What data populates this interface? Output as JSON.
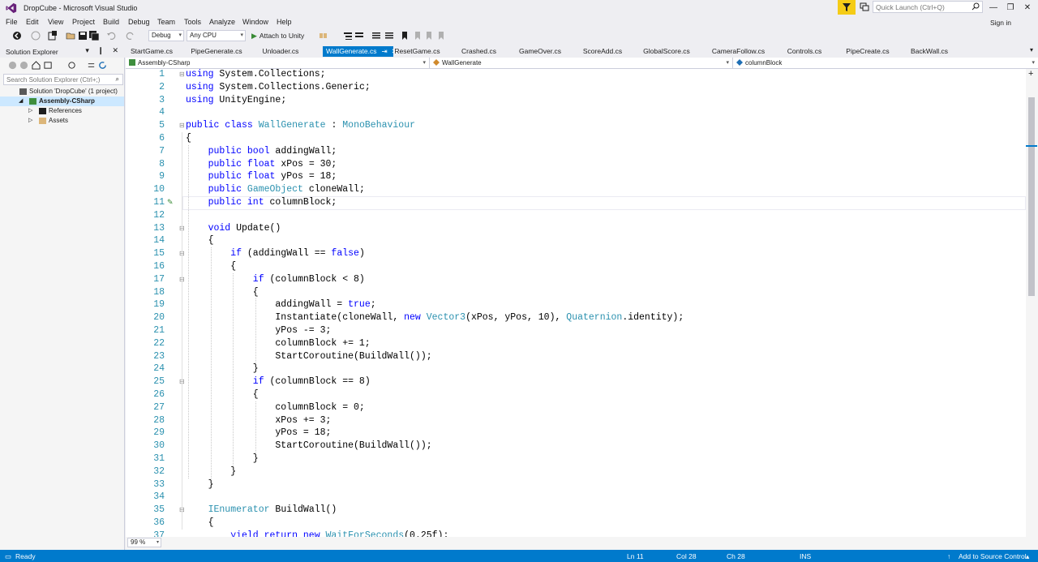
{
  "window": {
    "title": "DropCube - Microsoft Visual Studio",
    "quick_launch_placeholder": "Quick Launch (Ctrl+Q)",
    "sign_in": "Sign in",
    "controls": {
      "minimize": "—",
      "restore": "❐",
      "close": "✕"
    }
  },
  "menu": [
    "File",
    "Edit",
    "View",
    "Project",
    "Build",
    "Debug",
    "Team",
    "Tools",
    "Analyze",
    "Window",
    "Help"
  ],
  "toolbar": {
    "config": "Debug",
    "platform": "Any CPU",
    "attach": "Attach to Unity"
  },
  "solution_explorer": {
    "title": "Solution Explorer",
    "header_buttons": "▾ ❙ ✕",
    "search_placeholder": "Search Solution Explorer (Ctrl+;)",
    "tree": [
      {
        "label": "Solution 'DropCube' (1 project)",
        "expander": "",
        "level": 0,
        "selected": false,
        "icon": "solution-icon"
      },
      {
        "label": "Assembly-CSharp",
        "expander": "◢",
        "level": 1,
        "selected": true,
        "icon": "csharp-project-icon"
      },
      {
        "label": "References",
        "expander": "▷",
        "level": 2,
        "selected": false,
        "icon": "references-icon"
      },
      {
        "label": "Assets",
        "expander": "▷",
        "level": 2,
        "selected": false,
        "icon": "folder-icon"
      }
    ]
  },
  "tabs": [
    {
      "label": "StartGame.cs",
      "active": false
    },
    {
      "label": "PipeGenerate.cs",
      "active": false
    },
    {
      "label": "Unloader.cs",
      "active": false
    },
    {
      "label": "WallGenerate.cs",
      "active": true,
      "pin": "⇥",
      "close": "✕"
    },
    {
      "label": "ResetGame.cs",
      "active": false
    },
    {
      "label": "Crashed.cs",
      "active": false
    },
    {
      "label": "GameOver.cs",
      "active": false
    },
    {
      "label": "ScoreAdd.cs",
      "active": false
    },
    {
      "label": "GlobalScore.cs",
      "active": false
    },
    {
      "label": "CameraFollow.cs",
      "active": false
    },
    {
      "label": "Controls.cs",
      "active": false
    },
    {
      "label": "PipeCreate.cs",
      "active": false
    },
    {
      "label": "BackWall.cs",
      "active": false
    }
  ],
  "navbar": {
    "project": "Assembly-CSharp",
    "type": "WallGenerate",
    "member": "columnBlock"
  },
  "editor": {
    "zoom": "99 %",
    "lines": [
      {
        "n": "1",
        "fold": "⊟",
        "indent": 0,
        "tokens": [
          [
            "kw",
            "using"
          ],
          [
            "",
            " System.Collections;"
          ]
        ]
      },
      {
        "n": "2",
        "fold": "",
        "indent": 0,
        "tokens": [
          [
            "kw",
            "using"
          ],
          [
            "",
            " System.Collections.Generic;"
          ]
        ]
      },
      {
        "n": "3",
        "fold": "",
        "indent": 0,
        "tokens": [
          [
            "kw",
            "using"
          ],
          [
            "",
            " UnityEngine;"
          ]
        ]
      },
      {
        "n": "4",
        "fold": "",
        "indent": 0,
        "tokens": []
      },
      {
        "n": "5",
        "fold": "⊟",
        "indent": 0,
        "tokens": [
          [
            "kw",
            "public class"
          ],
          [
            "",
            " "
          ],
          [
            "ty",
            "WallGenerate"
          ],
          [
            "",
            " : "
          ],
          [
            "ty",
            "MonoBehaviour"
          ]
        ]
      },
      {
        "n": "6",
        "fold": "",
        "indent": 0,
        "tokens": [
          [
            "",
            "{"
          ]
        ]
      },
      {
        "n": "7",
        "fold": "",
        "indent": 1,
        "tokens": [
          [
            "kw",
            "public bool"
          ],
          [
            "",
            " addingWall;"
          ]
        ]
      },
      {
        "n": "8",
        "fold": "",
        "indent": 1,
        "tokens": [
          [
            "kw",
            "public float"
          ],
          [
            "",
            " xPos = 30;"
          ]
        ]
      },
      {
        "n": "9",
        "fold": "",
        "indent": 1,
        "tokens": [
          [
            "kw",
            "public float"
          ],
          [
            "",
            " yPos = 18;"
          ]
        ]
      },
      {
        "n": "10",
        "fold": "",
        "indent": 1,
        "tokens": [
          [
            "kw",
            "public"
          ],
          [
            "",
            " "
          ],
          [
            "ty",
            "GameObject"
          ],
          [
            "",
            " cloneWall;"
          ]
        ]
      },
      {
        "n": "11",
        "fold": "",
        "indent": 1,
        "tokens": [
          [
            "kw",
            "public int"
          ],
          [
            "",
            " columnBlock;"
          ]
        ]
      },
      {
        "n": "12",
        "fold": "",
        "indent": 0,
        "tokens": []
      },
      {
        "n": "13",
        "fold": "⊟",
        "indent": 1,
        "tokens": [
          [
            "kw",
            "void"
          ],
          [
            "",
            " Update()"
          ]
        ]
      },
      {
        "n": "14",
        "fold": "",
        "indent": 1,
        "tokens": [
          [
            "",
            "{"
          ]
        ]
      },
      {
        "n": "15",
        "fold": "⊟",
        "indent": 2,
        "tokens": [
          [
            "kw",
            "if"
          ],
          [
            "",
            " (addingWall == "
          ],
          [
            "kw",
            "false"
          ],
          [
            "",
            ")"
          ]
        ]
      },
      {
        "n": "16",
        "fold": "",
        "indent": 2,
        "tokens": [
          [
            "",
            "{"
          ]
        ]
      },
      {
        "n": "17",
        "fold": "⊟",
        "indent": 3,
        "tokens": [
          [
            "kw",
            "if"
          ],
          [
            "",
            " (columnBlock < 8)"
          ]
        ]
      },
      {
        "n": "18",
        "fold": "",
        "indent": 3,
        "tokens": [
          [
            "",
            "{"
          ]
        ]
      },
      {
        "n": "19",
        "fold": "",
        "indent": 4,
        "tokens": [
          [
            "",
            "addingWall = "
          ],
          [
            "kw",
            "true"
          ],
          [
            "",
            ";"
          ]
        ]
      },
      {
        "n": "20",
        "fold": "",
        "indent": 4,
        "tokens": [
          [
            "",
            "Instantiate(cloneWall, "
          ],
          [
            "kw",
            "new"
          ],
          [
            "",
            " "
          ],
          [
            "ty",
            "Vector3"
          ],
          [
            "",
            "(xPos, yPos, 10), "
          ],
          [
            "ty",
            "Quaternion"
          ],
          [
            "",
            ".identity);"
          ]
        ]
      },
      {
        "n": "21",
        "fold": "",
        "indent": 4,
        "tokens": [
          [
            "",
            "yPos -= 3;"
          ]
        ]
      },
      {
        "n": "22",
        "fold": "",
        "indent": 4,
        "tokens": [
          [
            "",
            "columnBlock += 1;"
          ]
        ]
      },
      {
        "n": "23",
        "fold": "",
        "indent": 4,
        "tokens": [
          [
            "",
            "StartCoroutine(BuildWall());"
          ]
        ]
      },
      {
        "n": "24",
        "fold": "",
        "indent": 3,
        "tokens": [
          [
            "",
            "}"
          ]
        ]
      },
      {
        "n": "25",
        "fold": "⊟",
        "indent": 3,
        "tokens": [
          [
            "kw",
            "if"
          ],
          [
            "",
            " (columnBlock == 8)"
          ]
        ]
      },
      {
        "n": "26",
        "fold": "",
        "indent": 3,
        "tokens": [
          [
            "",
            "{"
          ]
        ]
      },
      {
        "n": "27",
        "fold": "",
        "indent": 4,
        "tokens": [
          [
            "",
            "columnBlock = 0;"
          ]
        ]
      },
      {
        "n": "28",
        "fold": "",
        "indent": 4,
        "tokens": [
          [
            "",
            "xPos += 3;"
          ]
        ]
      },
      {
        "n": "29",
        "fold": "",
        "indent": 4,
        "tokens": [
          [
            "",
            "yPos = 18;"
          ]
        ]
      },
      {
        "n": "30",
        "fold": "",
        "indent": 4,
        "tokens": [
          [
            "",
            "StartCoroutine(BuildWall());"
          ]
        ]
      },
      {
        "n": "31",
        "fold": "",
        "indent": 3,
        "tokens": [
          [
            "",
            "}"
          ]
        ]
      },
      {
        "n": "32",
        "fold": "",
        "indent": 2,
        "tokens": [
          [
            "",
            "}"
          ]
        ]
      },
      {
        "n": "33",
        "fold": "",
        "indent": 1,
        "tokens": [
          [
            "",
            "}"
          ]
        ]
      },
      {
        "n": "34",
        "fold": "",
        "indent": 0,
        "tokens": []
      },
      {
        "n": "35",
        "fold": "⊟",
        "indent": 1,
        "tokens": [
          [
            "ty",
            "IEnumerator"
          ],
          [
            "",
            " BuildWall()"
          ]
        ]
      },
      {
        "n": "36",
        "fold": "",
        "indent": 1,
        "tokens": [
          [
            "",
            "{"
          ]
        ]
      },
      {
        "n": "37",
        "fold": "",
        "indent": 2,
        "tokens": [
          [
            "kw",
            "yield return new"
          ],
          [
            "",
            " "
          ],
          [
            "ty",
            "WaitForSeconds"
          ],
          [
            "",
            "(0.25f);"
          ]
        ]
      }
    ]
  },
  "statusbar": {
    "ready": "Ready",
    "ln": "Ln 11",
    "col": "Col 28",
    "ch": "Ch 28",
    "ins": "INS",
    "source_control": "Add to Source Control"
  },
  "colors": {
    "accent": "#007ACC",
    "keyword": "#0000FF",
    "type": "#2B91AF",
    "filter_yellow": "#F5CC17"
  }
}
